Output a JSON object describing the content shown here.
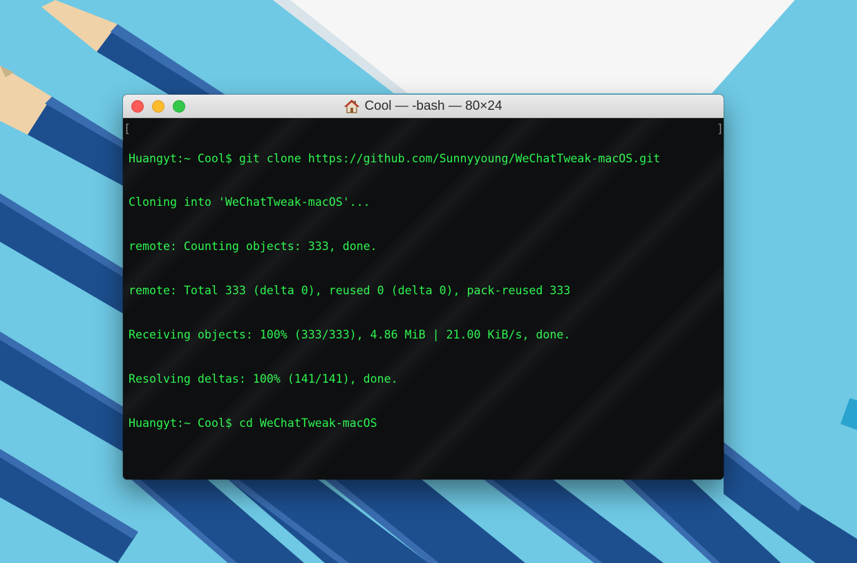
{
  "window": {
    "title": "Cool — -bash — 80×24",
    "title_icon": "home-icon",
    "traffic_lights": {
      "close": "#fc5b57",
      "minimize": "#fdbc2e",
      "zoom": "#34c84a"
    }
  },
  "terminal": {
    "text_color": "#2ef54f",
    "background": "#0d0f10",
    "bracket_left": "[",
    "bracket_right": "]",
    "lines": [
      "Huangyt:~ Cool$ git clone https://github.com/Sunnyyoung/WeChatTweak-macOS.git",
      "Cloning into 'WeChatTweak-macOS'...",
      "remote: Counting objects: 333, done.",
      "remote: Total 333 (delta 0), reused 0 (delta 0), pack-reused 333",
      "Receiving objects: 100% (333/333), 4.86 MiB | 21.00 KiB/s, done.",
      "Resolving deltas: 100% (141/141), done.",
      "Huangyt:~ Cool$ cd WeChatTweak-macOS"
    ]
  },
  "background": {
    "color": "#6fc9e4",
    "pencil_color": "#1d4f8f",
    "paper_color": "#f6f6f6"
  }
}
